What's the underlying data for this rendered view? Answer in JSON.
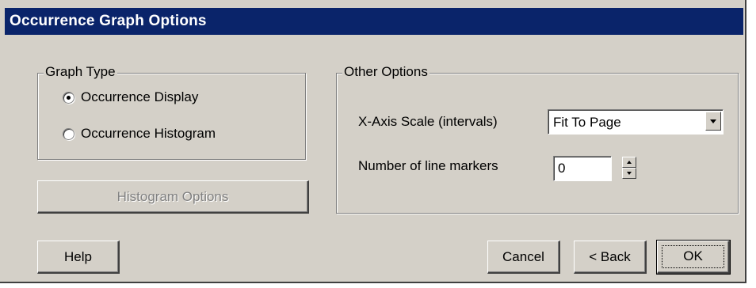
{
  "window": {
    "title": "Occurrence Graph Options"
  },
  "graph_type": {
    "legend": "Graph Type",
    "options": [
      {
        "label": "Occurrence Display",
        "selected": true
      },
      {
        "label": "Occurrence Histogram",
        "selected": false
      }
    ]
  },
  "histogram_options_button": {
    "label": "Histogram Options",
    "enabled": false
  },
  "other_options": {
    "legend": "Other Options",
    "x_axis_scale": {
      "label": "X-Axis Scale (intervals)",
      "value": "Fit To Page"
    },
    "line_markers": {
      "label": "Number of line markers",
      "value": "0"
    }
  },
  "footer": {
    "help_label": "Help",
    "cancel_label": "Cancel",
    "back_label": "< Back",
    "ok_label": "OK"
  },
  "colors": {
    "titlebar": "#0a246a",
    "face": "#d4d0c8"
  },
  "icons": {
    "combo_arrow": "chevron-down-icon",
    "spin_up": "spin-up-icon",
    "spin_down": "spin-down-icon"
  }
}
